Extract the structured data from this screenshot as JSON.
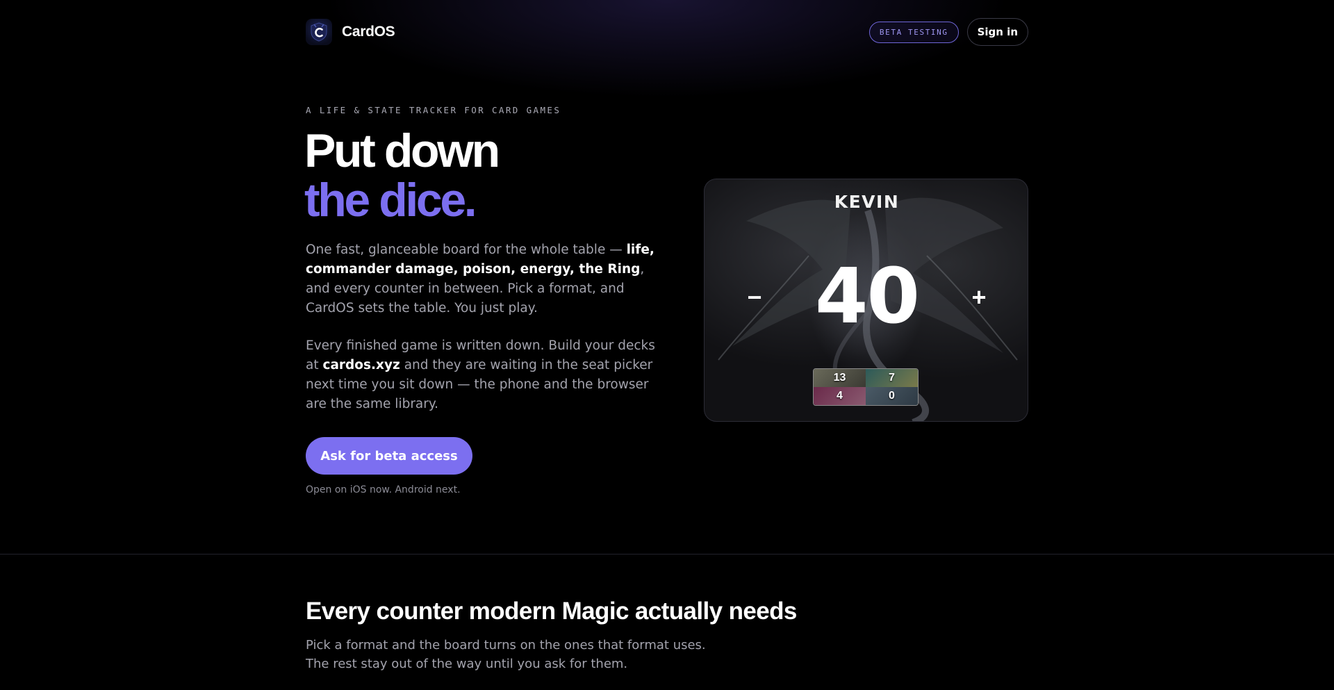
{
  "header": {
    "brand_name": "CardOS",
    "logo_icon": "shield-c-logo",
    "beta_badge": "BETA TESTING",
    "signin_label": "Sign in"
  },
  "hero": {
    "kicker": "A LIFE & STATE TRACKER FOR CARD GAMES",
    "headline_line1": "Put down",
    "headline_line2": "the dice.",
    "p1_intro": "One fast, glanceable board for the whole table — ",
    "p1_bold": "life, commander damage, poison, energy, the Ring",
    "p1_rest": ", and every counter in between. Pick a format, and CardOS sets the table. You just play.",
    "p2_intro": "Every finished game is written down. Build your decks at ",
    "p2_bold": "cardos.xyz",
    "p2_rest": " and they are waiting in the seat picker next time you sit down — the phone and the browser are the same library.",
    "cta_label": "Ask for beta access",
    "cta_note": "Open on iOS now. Android next."
  },
  "player_card": {
    "name": "KEVIN",
    "life": "40",
    "minus_label": "−",
    "plus_label": "+",
    "counters": [
      "13",
      "7",
      "4",
      "0"
    ]
  },
  "section": {
    "title": "Every counter modern Magic actually needs",
    "sub_line1": "Pick a format and the board turns on the ones that format uses.",
    "sub_line2": "The rest stay out of the way until you ask for them."
  },
  "colors": {
    "accent": "#7c6ff0",
    "background": "#000000",
    "muted_text": "#a3a3ad"
  }
}
